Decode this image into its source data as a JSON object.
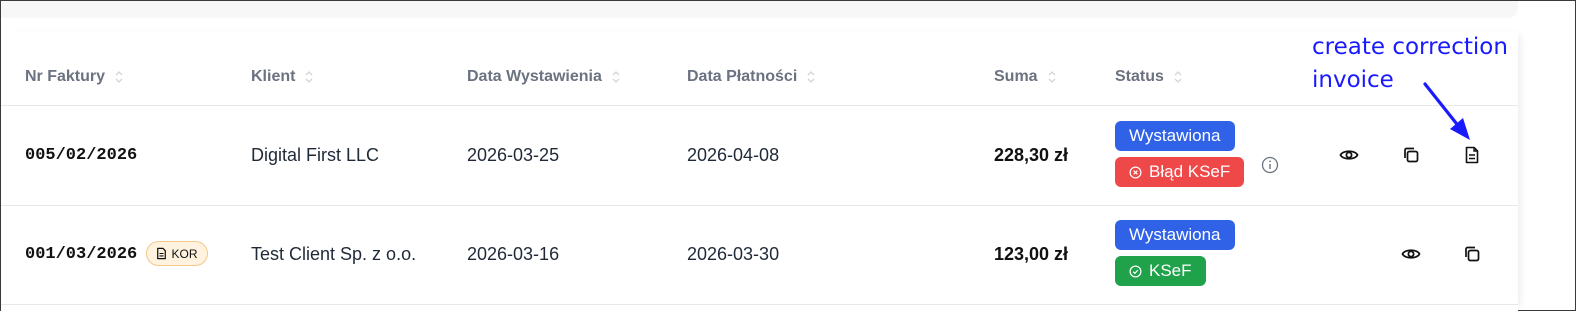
{
  "table": {
    "columns": [
      {
        "label": "Nr Faktury"
      },
      {
        "label": "Klient"
      },
      {
        "label": "Data Wystawienia"
      },
      {
        "label": "Data Płatności"
      },
      {
        "label": "Suma"
      },
      {
        "label": "Status"
      }
    ],
    "rows": [
      {
        "invoice_number": "005/02/2026",
        "client": "Digital First LLC",
        "issue_date": "2026-03-25",
        "payment_date": "2026-04-08",
        "total": "228,30 zł",
        "status_primary": "Wystawiona",
        "status_secondary": "Błąd KSeF"
      },
      {
        "invoice_number": "001/03/2026",
        "correction_badge": "KOR",
        "client": "Test Client Sp. z o.o.",
        "issue_date": "2026-03-16",
        "payment_date": "2026-03-30",
        "total": "123,00 zł",
        "status_primary": "Wystawiona",
        "status_secondary": "KSeF"
      }
    ]
  },
  "annotation": {
    "line1": "create correction",
    "line2": "invoice"
  },
  "colors": {
    "status_blue": "#2f62e6",
    "status_error": "#ef4848",
    "status_ok": "#20a24b",
    "annotation": "#1a1aff",
    "correction_badge_bg": "#fff3df"
  },
  "icons": [
    "sort-icon",
    "info-icon",
    "eye-icon",
    "copy-icon",
    "file-text-icon",
    "x-circle-icon",
    "check-circle-icon",
    "arrow-icon"
  ]
}
